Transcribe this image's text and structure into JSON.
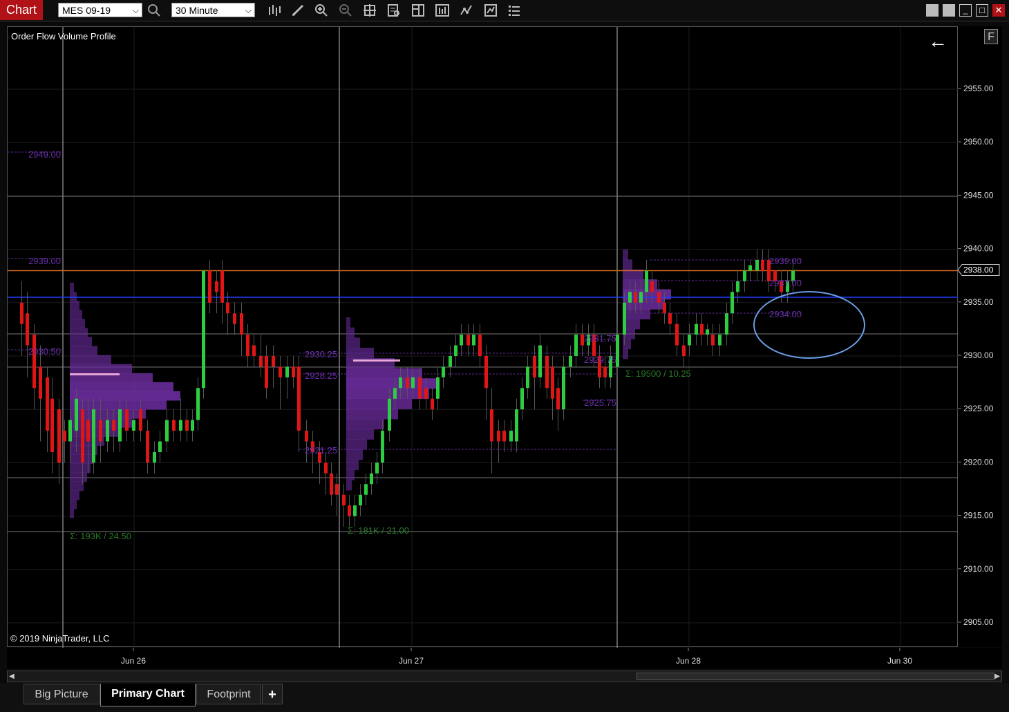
{
  "toolbar": {
    "app_label": "Chart",
    "instrument": "MES 09-19",
    "interval": "30 Minute",
    "icons": [
      "search-icon",
      "bar-type-icon",
      "drawing-tools-icon",
      "zoom-in-icon",
      "zoom-out-icon",
      "crosshair-icon",
      "data-box-icon",
      "properties-icon",
      "strategies-icon",
      "indicators-icon",
      "templates-icon",
      "list-icon"
    ]
  },
  "window_controls": {
    "close": "✕",
    "maximize": "□",
    "minimize": "_"
  },
  "chart": {
    "indicator_title": "Order Flow Volume Profile",
    "copyright": "© 2019 NinjaTrader, LLC",
    "float_button": "F",
    "back_arrow": "←",
    "current_price": "2938.00",
    "price_ticks": [
      "2955.00",
      "2950.00",
      "2945.00",
      "2940.00",
      "2935.00",
      "2930.00",
      "2925.00",
      "2920.00",
      "2915.00",
      "2910.00",
      "2905.00"
    ],
    "date_labels": [
      "Jun 26",
      "Jun 27",
      "Jun 28",
      "Jun 30"
    ],
    "profile_labels": [
      {
        "text": "2949.00",
        "color": "#6a2fa8"
      },
      {
        "text": "2939.00",
        "color": "#6a2fa8"
      },
      {
        "text": "2930.50",
        "color": "#6a2fa8"
      },
      {
        "text": "Σ: 193K / 24.50",
        "color": "#2a7a2a"
      },
      {
        "text": "2930.25",
        "color": "#6a2fa8"
      },
      {
        "text": "2928.25",
        "color": "#6a2fa8"
      },
      {
        "text": "2921.25",
        "color": "#6a2fa8"
      },
      {
        "text": "Σ: 181K / 21.00",
        "color": "#2a7a2a"
      },
      {
        "text": "2931.75",
        "color": "#6a2fa8"
      },
      {
        "text": "2929.75",
        "color": "#6a2fa8"
      },
      {
        "text": "2925.75",
        "color": "#6a2fa8"
      },
      {
        "text": "2939.00",
        "color": "#6a2fa8"
      },
      {
        "text": "2937.00",
        "color": "#6a2fa8"
      },
      {
        "text": "2934.00",
        "color": "#6a2fa8"
      },
      {
        "text": "Σ: 19500 / 10.25",
        "color": "#2a7a2a"
      }
    ],
    "colors": {
      "up": "#2ecc40",
      "down": "#e01515",
      "orange_line": "#d2691e",
      "blue_line": "#1e3cff",
      "ellipse": "#6a9ee8",
      "profile": "#6b2d9e"
    }
  },
  "tabs": [
    {
      "label": "Big Picture",
      "active": false
    },
    {
      "label": "Primary Chart",
      "active": true
    },
    {
      "label": "Footprint",
      "active": false
    }
  ],
  "add_tab": "+"
}
